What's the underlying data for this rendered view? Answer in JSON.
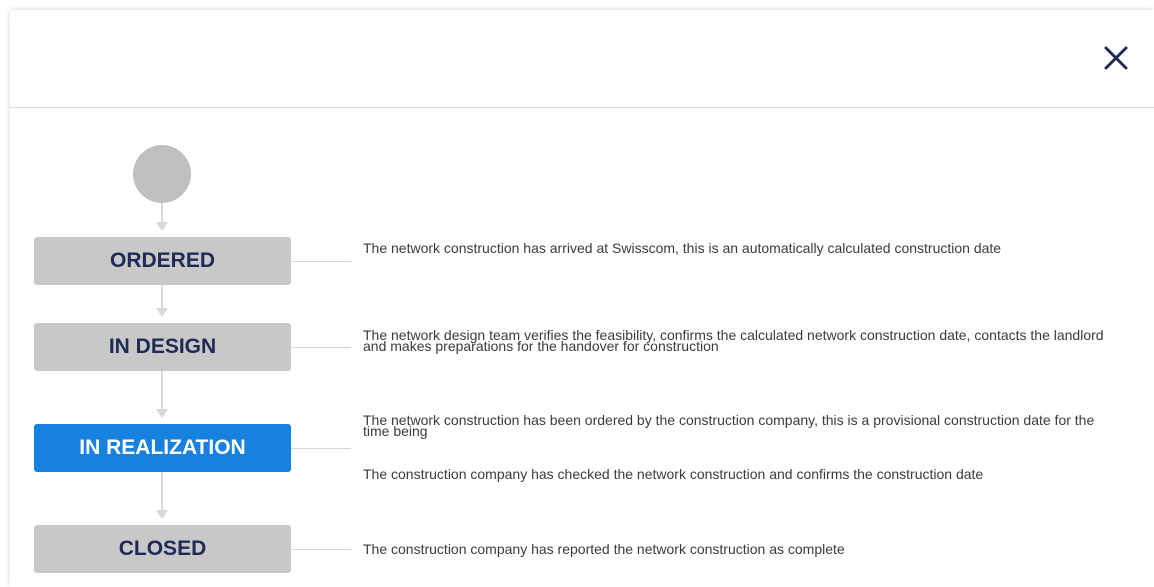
{
  "dialog": {
    "close_label": "×"
  },
  "workflow": {
    "states": [
      {
        "label": "ORDERED",
        "active": false,
        "descriptions": [
          "The network construction has arrived at Swisscom, this is an automatically calculated construction date"
        ]
      },
      {
        "label": "IN DESIGN",
        "active": false,
        "descriptions": [
          "The network design team verifies the feasibility, confirms the calculated network construction date, contacts the landlord and makes preparations for the handover for construction"
        ]
      },
      {
        "label": "IN REALIZATION",
        "active": true,
        "descriptions": [
          "The network construction has been ordered by the construction company, this is a provisional construction date for the time being",
          "The construction company has checked the network construction and confirms the construction date"
        ]
      },
      {
        "label": "CLOSED",
        "active": false,
        "descriptions": [
          "The construction company has reported the network construction as complete"
        ]
      }
    ]
  },
  "colors": {
    "state_default": "#c8c8c8",
    "state_active": "#1781e0",
    "state_text": "#1f2a56",
    "start_node": "#bfbfbf",
    "close_icon": "#1f2a56"
  }
}
